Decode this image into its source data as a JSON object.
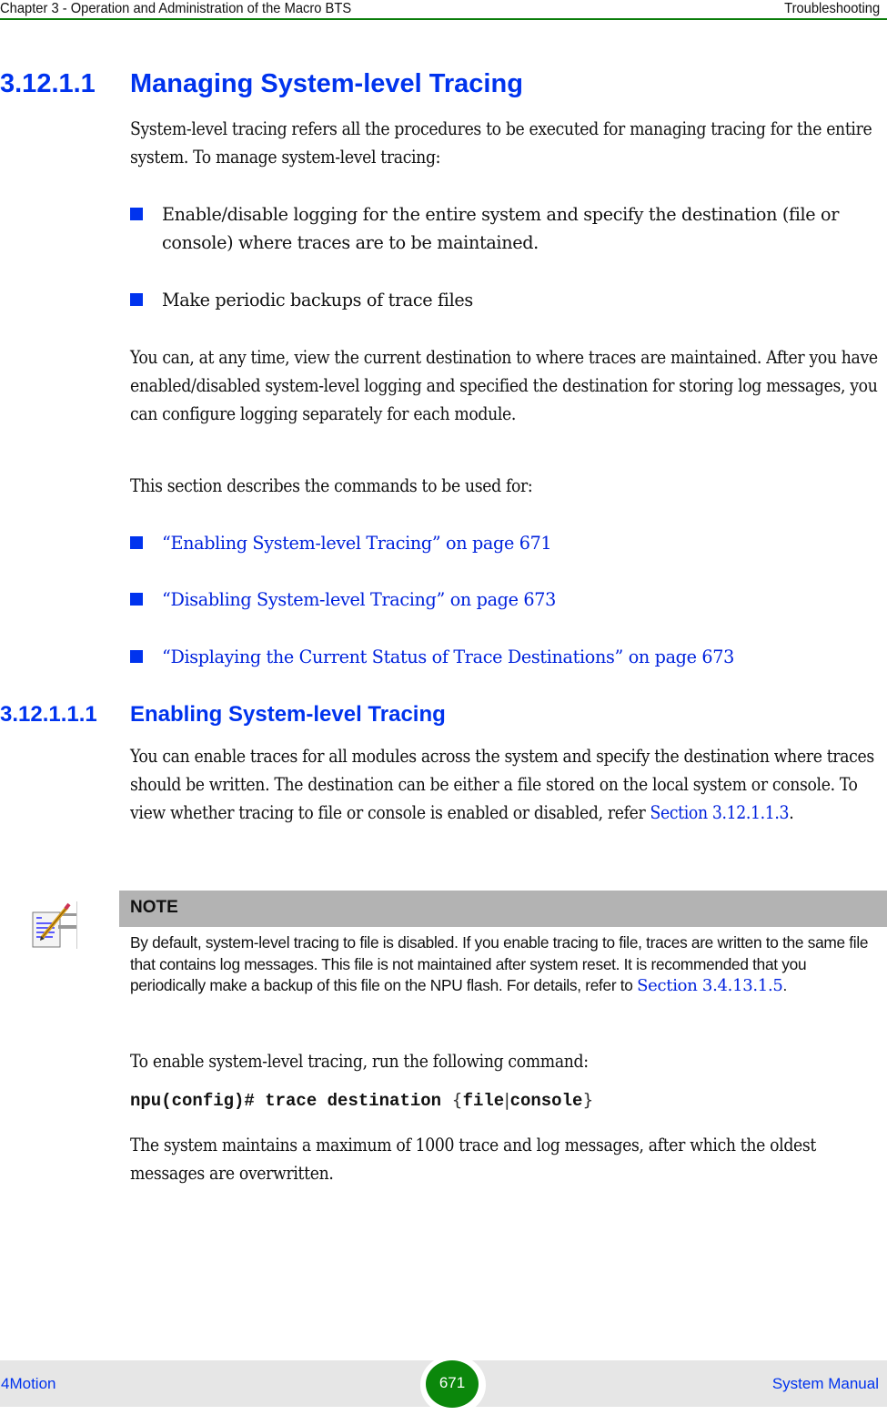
{
  "header": {
    "chapter_title": "Chapter 3 - Operation and Administration of the Macro BTS",
    "section_title": "Troubleshooting"
  },
  "section": {
    "number": "3.12.1.1",
    "title": "Managing System-level Tracing",
    "intro": "System-level tracing refers all the procedures to be executed for managing tracing for the entire system. To manage system-level tracing:",
    "bullets": [
      "Enable/disable logging for the entire system and specify the destination (file or console) where traces are to be maintained.",
      "Make periodic backups of trace files"
    ],
    "para2": "You can, at any time, view the current destination to where traces are maintained. After you have enabled/disabled system-level logging and specified the destination for storing log messages, you can configure logging separately for each module.",
    "para3": "This section describes the commands to be used for:",
    "links": [
      "“Enabling System-level Tracing” on page 671",
      "“Disabling System-level Tracing” on page 673",
      "“Displaying the Current Status of Trace Destinations” on page 673"
    ]
  },
  "subsection": {
    "number": "3.12.1.1.1",
    "title": "Enabling System-level Tracing",
    "para1_text": "You can enable traces for all modules across the system and specify the destination where traces should be written. The destination can be either a file stored on the local system or console. To view whether tracing to file or console is enabled or disabled, refer ",
    "para1_link": "Section 3.12.1.1.3",
    "para1_end": ".",
    "note": {
      "title": "NOTE",
      "body": "By default, system-level tracing to file is disabled. If you enable tracing to file, traces are written to the same file that contains log messages. This file is not maintained after system reset. It is recommended that you periodically make a backup of this file on the NPU flash. For details, refer to ",
      "link": "Section 3.4.13.1.5",
      "end": "."
    },
    "para2": "To enable system-level tracing, run the following command:",
    "command": {
      "prompt": "npu(config)# trace destination ",
      "open_brace": "{",
      "opt1": "file",
      "sep": "|",
      "opt2": "console",
      "close_brace": "}"
    },
    "para3": "The system maintains a maximum of 1000 trace and log messages, after which the oldest messages are overwritten."
  },
  "footer": {
    "product": "4Motion",
    "page_number": "671",
    "doc_title": "System Manual"
  },
  "colors": {
    "heading_blue": "#0033ee",
    "header_rule_green": "#0a7d0a",
    "page_badge_green": "#0b870b",
    "note_bar_gray": "#b3b3b3",
    "footer_gray": "#e6e6e6"
  }
}
